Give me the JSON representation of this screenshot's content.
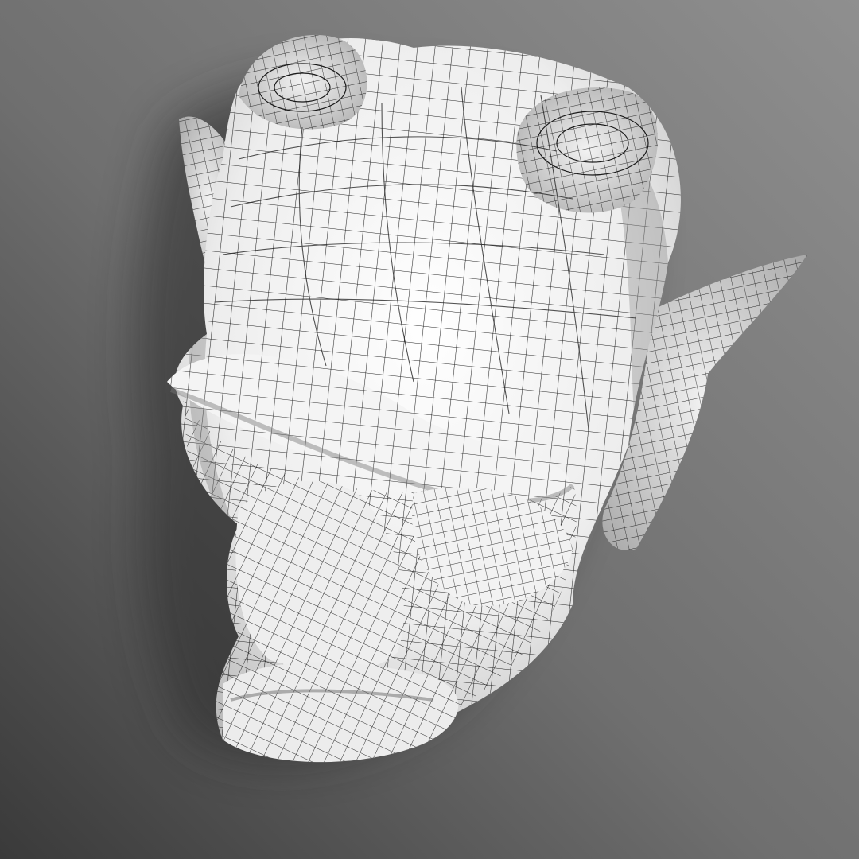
{
  "scene": {
    "subject": "wireframe-demon-head-render",
    "colors": {
      "background_light": "#8f8f8f",
      "background_dark": "#3a3a3a",
      "mesh_surface": "#f4f4f4",
      "mesh_shadow": "#b9b9b9",
      "wire": "#1a1a1a",
      "cast_shadow": "#2a2a2a"
    },
    "icons": {
      "model": "demon-head-wireframe-icon"
    }
  }
}
